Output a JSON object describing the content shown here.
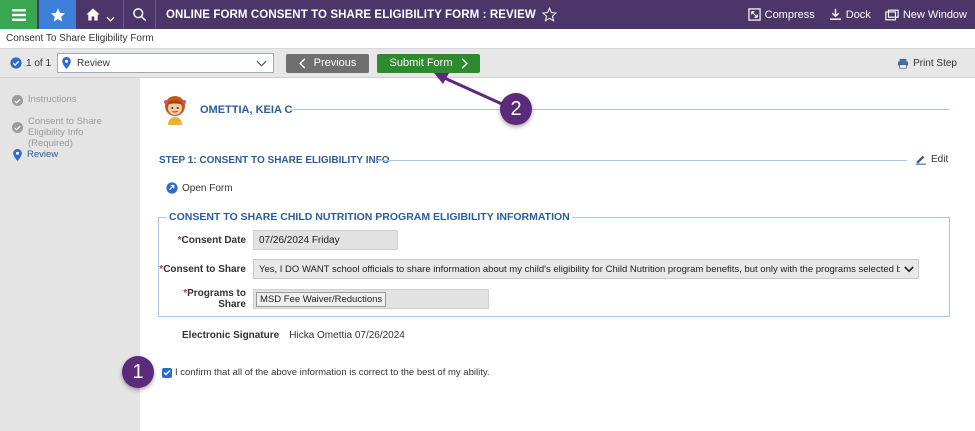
{
  "topbar": {
    "title": "ONLINE FORM CONSENT TO SHARE ELIGIBILITY FORM : REVIEW",
    "compress": "Compress",
    "dock": "Dock",
    "new_window": "New Window"
  },
  "breadcrumb": "Consent To Share Eligibility Form",
  "toolbar": {
    "pager": "1 of 1",
    "step_select": "Review",
    "previous": "Previous",
    "submit": "Submit Form",
    "print": "Print Step"
  },
  "sidebar": {
    "items": [
      {
        "label": "Instructions"
      },
      {
        "label": "Consent to Share Eligibility Info (Required)"
      },
      {
        "label": "Review"
      }
    ]
  },
  "main": {
    "student_name": "OMETTIA, KEIA C",
    "step_heading": "STEP 1: CONSENT TO SHARE ELIGIBILITY INFO",
    "edit": "Edit",
    "open_form": "Open Form",
    "section_title": "CONSENT TO SHARE CHILD NUTRITION PROGRAM ELIGIBILITY INFORMATION",
    "fields": {
      "consent_date_label": "Consent Date",
      "consent_date_value": "07/26/2024 Friday",
      "consent_share_label": "Consent to Share",
      "consent_share_value": "Yes, I DO WANT school officials to share information about my child's eligibility for Child Nutrition program benefits, but only with the programs selected below.",
      "programs_label": "Programs to Share",
      "programs_value": "MSD Fee Waiver/Reductions"
    },
    "signature_label": "Electronic Signature",
    "signature_value": "Hicka Omettia 07/26/2024",
    "confirm_text": "I confirm that all of the above information is correct to the best of my ability."
  },
  "callouts": [
    "1",
    "2"
  ],
  "colors": {
    "topbar": "#4b3569",
    "menu_green": "#3aa651",
    "star_blue": "#3d7fd9",
    "submit_green": "#2f8a2f",
    "heading_blue": "#2c5d9a",
    "callout_purple": "#5b2a7a"
  }
}
